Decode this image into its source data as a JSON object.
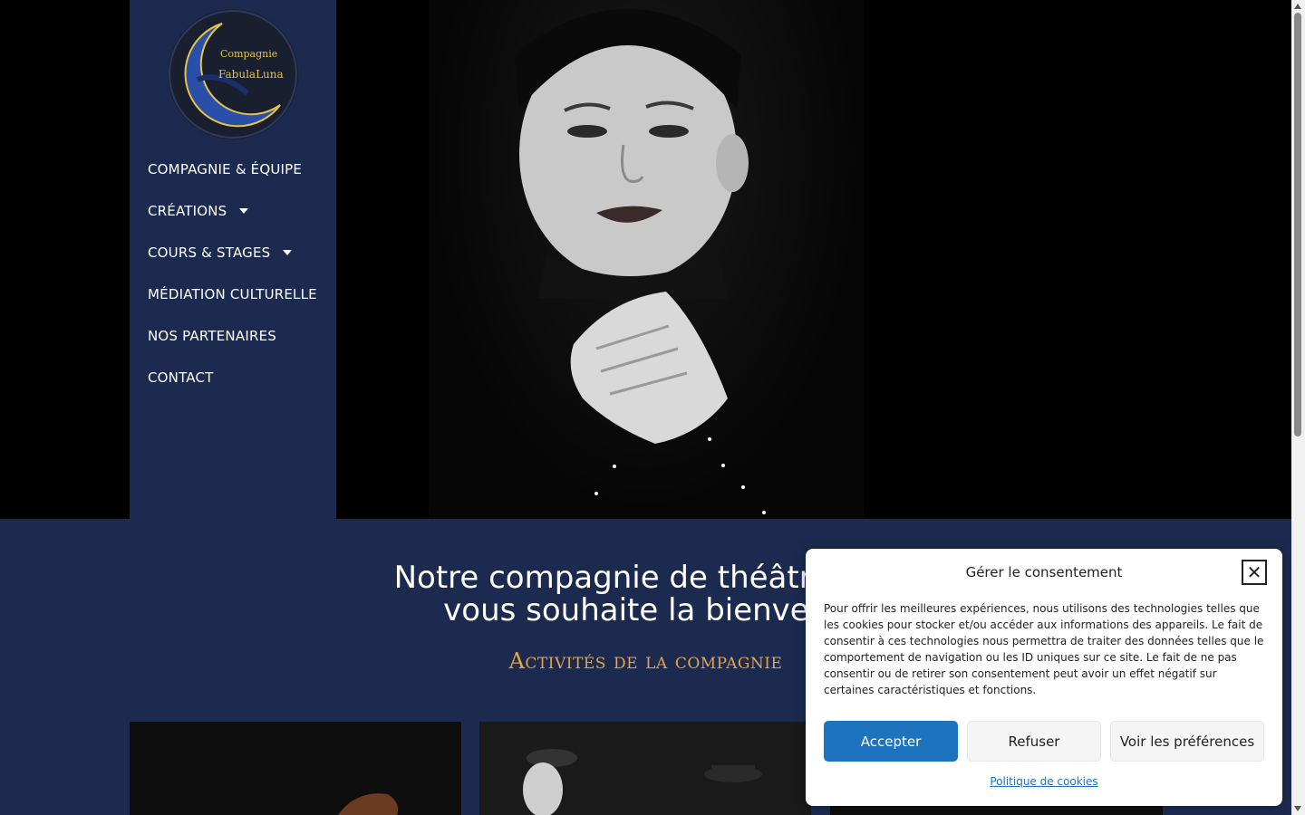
{
  "colors": {
    "sidebar_bg": "#1c2a50",
    "accent_gold": "#e3a54a",
    "accept_button": "#1e73be"
  },
  "logo": {
    "line1": "Compagnie",
    "line2": "FabulaLuna"
  },
  "nav": {
    "items": [
      {
        "label": "COMPAGNIE & ÉQUIPE"
      },
      {
        "label": "CRÉATIONS"
      },
      {
        "label": "COURS & STAGES"
      },
      {
        "label": "MÉDIATION CULTURELLE"
      },
      {
        "label": "NOS PARTENAIRES"
      },
      {
        "label": "CONTACT"
      }
    ]
  },
  "main": {
    "headline_line1": "Notre compagnie de théâtre et c",
    "headline_line2": "vous souhaite la bienvenu",
    "subtitle": "Activités de la compagnie"
  },
  "cookie": {
    "title": "Gérer le consentement",
    "close_icon": "close-icon",
    "body": "Pour offrir les meilleures expériences, nous utilisons des technologies telles que les cookies pour stocker et/ou accéder aux informations des appareils. Le fait de consentir à ces technologies nous permettra de traiter des données telles que le comportement de navigation ou les ID uniques sur ce site. Le fait de ne pas consentir ou de retirer son consentement peut avoir un effet négatif sur certaines caractéristiques et fonctions.",
    "accept": "Accepter",
    "refuse": "Refuser",
    "preferences": "Voir les préférences",
    "policy_link": "Politique de cookies"
  }
}
